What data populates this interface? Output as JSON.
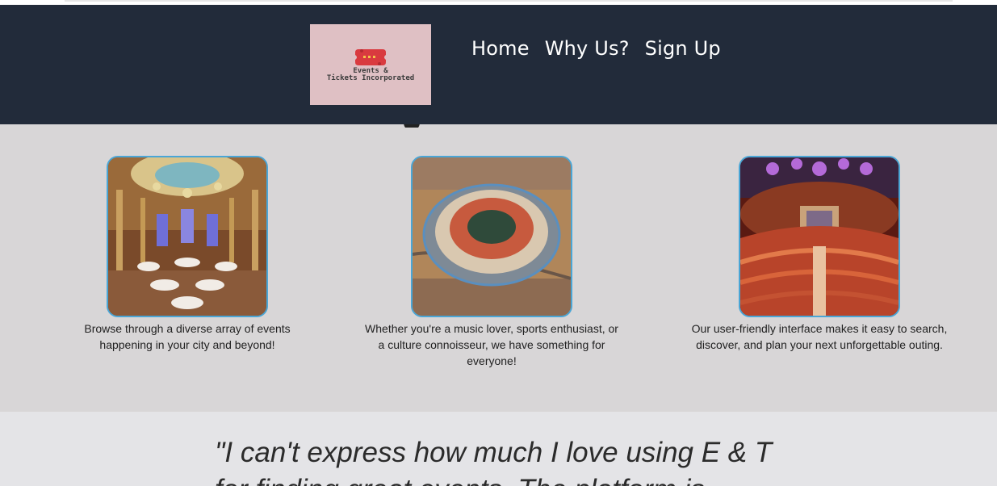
{
  "header": {
    "logo": {
      "line1": "Events &",
      "line2": "Tickets Incorporated"
    },
    "nav": [
      "Home",
      "Why Us?",
      "Sign Up"
    ]
  },
  "features": [
    {
      "caption": "Browse through a diverse array of events happening in your city and beyond!",
      "image": "banquet-hall-photo"
    },
    {
      "caption": "Whether you're a music lover, sports enthusiast, or a culture connoisseur, we have something for everyone!",
      "image": "stadium-aerial-photo"
    },
    {
      "caption": "Our user-friendly interface makes it easy to search, discover, and plan your next unforgettable outing.",
      "image": "concert-hall-photo"
    }
  ],
  "testimonial": {
    "quote": "\"I can't express how much I love using E & T for finding great events. The platform is"
  },
  "colors": {
    "header_bg": "#222b3a",
    "section_bg": "#d8d6d7",
    "testimonial_bg": "#e4e4e7",
    "photo_border": "#4aa6d6"
  }
}
